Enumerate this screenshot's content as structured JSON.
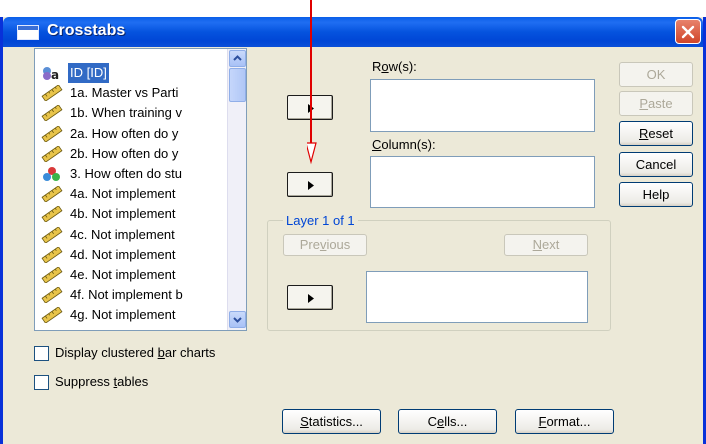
{
  "window": {
    "title": "Crosstabs",
    "close_icon": "close-icon"
  },
  "variables": [
    {
      "label": "ID [ID]",
      "icon": "nominal-id-icon",
      "selected": true
    },
    {
      "label": "1a. Master vs Parti",
      "icon": "scale-ruler-icon"
    },
    {
      "label": "1b. When training v",
      "icon": "scale-ruler-icon"
    },
    {
      "label": "2a. How often do y",
      "icon": "scale-ruler-icon"
    },
    {
      "label": "2b. How often do y",
      "icon": "scale-ruler-icon"
    },
    {
      "label": "3. How often do stu",
      "icon": "nominal-balls-icon"
    },
    {
      "label": "4a. Not implement",
      "icon": "scale-ruler-icon"
    },
    {
      "label": "4b. Not implement",
      "icon": "scale-ruler-icon"
    },
    {
      "label": "4c. Not implement",
      "icon": "scale-ruler-icon"
    },
    {
      "label": "4d. Not implement",
      "icon": "scale-ruler-icon"
    },
    {
      "label": "4e. Not implement",
      "icon": "scale-ruler-icon"
    },
    {
      "label": "4f. Not implement b",
      "icon": "scale-ruler-icon"
    },
    {
      "label": "4g. Not implement",
      "icon": "scale-ruler-icon"
    }
  ],
  "targets": {
    "rows_pre": "R",
    "rows_key": "o",
    "rows_post": "w(s):",
    "columns_key": "C",
    "columns_post": "olumn(s):"
  },
  "layer": {
    "title": "Layer 1 of 1",
    "previous_pre": "Pre",
    "previous_key": "v",
    "previous_post": "ious",
    "next_key": "N",
    "next_post": "ext"
  },
  "right_buttons": {
    "ok": "OK",
    "paste_key": "P",
    "paste_post": "aste",
    "reset_key": "R",
    "reset_post": "eset",
    "cancel": "Cancel",
    "help": "Help"
  },
  "options": {
    "clustered_pre": "Display clustered ",
    "clustered_key": "b",
    "clustered_post": "ar charts",
    "suppress_pre": "Suppress ",
    "suppress_key": "t",
    "suppress_post": "ables"
  },
  "bottom_buttons": {
    "statistics_key": "S",
    "statistics_post": "tatistics...",
    "cells_pre": "C",
    "cells_key": "e",
    "cells_post": "lls...",
    "format_key": "F",
    "format_post": "ormat..."
  },
  "colors": {
    "title_bar": "#0553de",
    "selection": "#316ac5",
    "annotation": "#e00000"
  }
}
